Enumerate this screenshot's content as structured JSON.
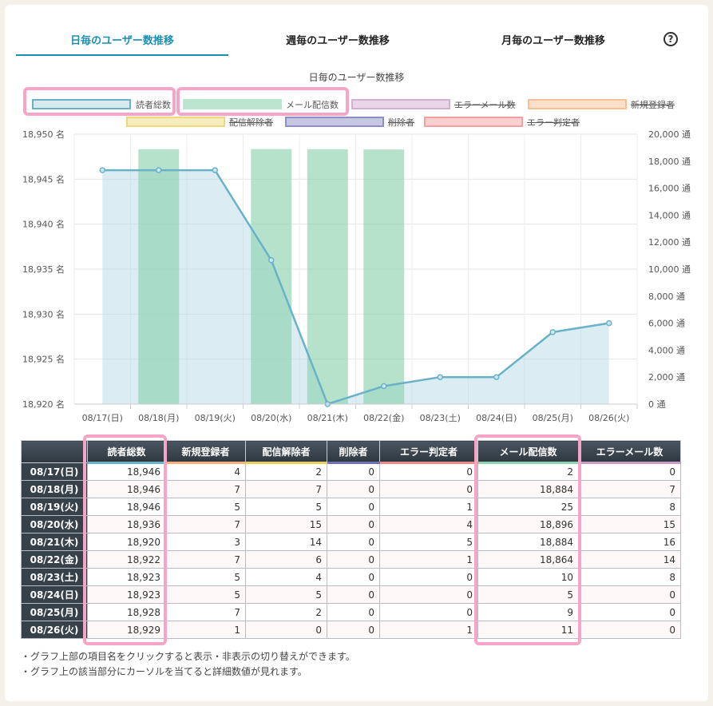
{
  "tabs": {
    "daily": "日毎のユーザー数推移",
    "weekly": "週毎のユーザー数推移",
    "monthly": "月毎のユーザー数推移",
    "help": "?"
  },
  "chart_data": {
    "type": "bar",
    "title": "日毎のユーザー数推移",
    "categories": [
      "08/17(日)",
      "08/18(月)",
      "08/19(火)",
      "08/20(水)",
      "08/21(木)",
      "08/22(金)",
      "08/23(土)",
      "08/24(日)",
      "08/25(月)",
      "08/26(火)"
    ],
    "legend": [
      {
        "name": "読者総数",
        "color": "#6ab2c8",
        "hidden": false
      },
      {
        "name": "メール配信数",
        "color": "#8fd3b0",
        "hidden": false
      },
      {
        "name": "エラーメール数",
        "color": "#c99bc6",
        "hidden": true
      },
      {
        "name": "新規登録者",
        "color": "#f8b07a",
        "hidden": true
      },
      {
        "name": "配信解除者",
        "color": "#e8cf5a",
        "hidden": true
      },
      {
        "name": "削除者",
        "color": "#6f72b8",
        "hidden": true
      },
      {
        "name": "エラー判定者",
        "color": "#ef8a8a",
        "hidden": true
      }
    ],
    "series": [
      {
        "name": "読者総数",
        "type": "line-area",
        "axis": "left",
        "values": [
          18946,
          18946,
          18946,
          18936,
          18920,
          18922,
          18923,
          18923,
          18928,
          18929
        ]
      },
      {
        "name": "メール配信数",
        "type": "bar",
        "axis": "right",
        "values": [
          2,
          18884,
          25,
          18896,
          18884,
          18864,
          10,
          5,
          9,
          11
        ]
      }
    ],
    "left_axis": {
      "min": 18920,
      "max": 18950,
      "step": 5,
      "unit": "名"
    },
    "right_axis": {
      "min": 0,
      "max": 20000,
      "step": 2000,
      "unit": "通"
    },
    "grid": true,
    "legend_position": "top"
  },
  "table": {
    "headers": [
      "読者総数",
      "新規登録者",
      "配信解除者",
      "削除者",
      "エラー判定者",
      "メール配信数",
      "エラーメール数"
    ],
    "header_colors": [
      "#6ab2c8",
      "#f8b07a",
      "#e8cf5a",
      "#6f72b8",
      "#ef8a8a",
      "#8fd3b0",
      "#c99bc6"
    ],
    "rows": [
      {
        "date": "08/17(日)",
        "cells": [
          "18,946",
          "4",
          "2",
          "0",
          "0",
          "2",
          "0"
        ]
      },
      {
        "date": "08/18(月)",
        "cells": [
          "18,946",
          "7",
          "7",
          "0",
          "0",
          "18,884",
          "7"
        ]
      },
      {
        "date": "08/19(火)",
        "cells": [
          "18,946",
          "5",
          "5",
          "0",
          "1",
          "25",
          "8"
        ]
      },
      {
        "date": "08/20(水)",
        "cells": [
          "18,936",
          "7",
          "15",
          "0",
          "4",
          "18,896",
          "15"
        ]
      },
      {
        "date": "08/21(木)",
        "cells": [
          "18,920",
          "3",
          "14",
          "0",
          "5",
          "18,884",
          "16"
        ]
      },
      {
        "date": "08/22(金)",
        "cells": [
          "18,922",
          "7",
          "6",
          "0",
          "1",
          "18,864",
          "14"
        ]
      },
      {
        "date": "08/23(土)",
        "cells": [
          "18,923",
          "5",
          "4",
          "0",
          "0",
          "10",
          "8"
        ]
      },
      {
        "date": "08/24(日)",
        "cells": [
          "18,923",
          "5",
          "5",
          "0",
          "0",
          "5",
          "0"
        ]
      },
      {
        "date": "08/25(月)",
        "cells": [
          "18,928",
          "7",
          "2",
          "0",
          "0",
          "9",
          "0"
        ]
      },
      {
        "date": "08/26(火)",
        "cells": [
          "18,929",
          "1",
          "0",
          "0",
          "1",
          "11",
          "0"
        ]
      }
    ]
  },
  "notes": [
    "・グラフ上部の項目名をクリックすると表示・非表示の切り替えができます。",
    "・グラフ上の該当部分にカーソルを当てると詳細数値が見れます。"
  ]
}
